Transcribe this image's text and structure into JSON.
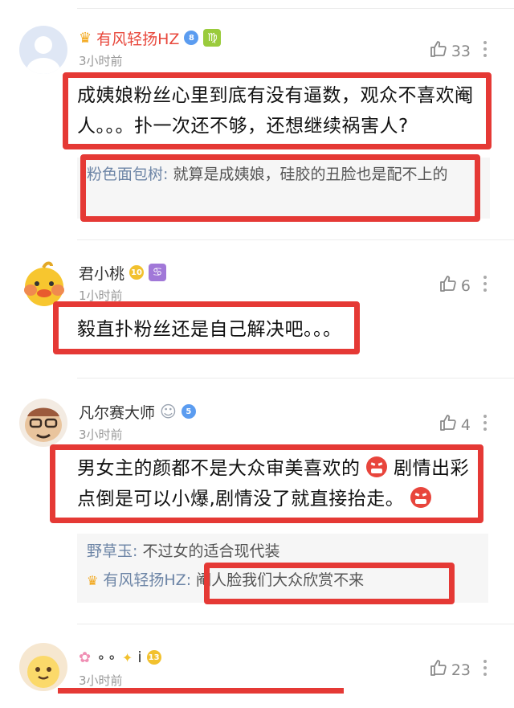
{
  "colors": {
    "vip_name": "#e8483c",
    "reply_name": "#6d85a6",
    "highlight_box": "#e53935",
    "meta_gray": "#999999"
  },
  "comments": [
    {
      "username": "有风轻扬HZ",
      "level": "8",
      "zodiac_glyph": "♍",
      "time": "3小时前",
      "likes": "33",
      "text": "成姨娘粉丝心里到底有没有逼数，观众不喜欢阉人。。。扑一次还不够，还想继续祸害人?",
      "replies": [
        {
          "name": "粉色面包树:",
          "text": "就算是成姨娘，硅胶的丑脸也是配不上的"
        }
      ]
    },
    {
      "username": "君小桃",
      "level": "10",
      "zodiac_glyph": "♋",
      "time": "1小时前",
      "likes": "6",
      "text": "毅直扑粉丝还是自己解决吧。。。"
    },
    {
      "username": "凡尔赛大师",
      "level": "5",
      "time": "3小时前",
      "likes": "4",
      "text_part1": "男女主的颜都不是大众审美喜欢的",
      "text_part2": "剧情出彩点倒是可以小爆,剧情没了就直接抬走。",
      "replies": [
        {
          "name": "野草玉:",
          "text": "不过女的适合现代装"
        },
        {
          "name": "有风轻扬HZ:",
          "text": "阉人脸我们大众欣赏不来"
        }
      ]
    },
    {
      "username": "i",
      "level": "13",
      "time": "3小时前",
      "likes": "23"
    }
  ]
}
